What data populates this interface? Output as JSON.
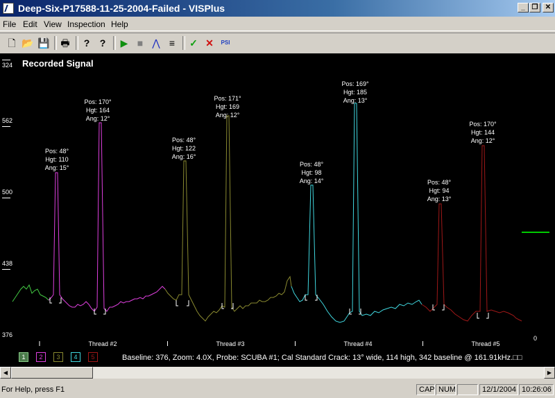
{
  "window": {
    "title": "Deep-Six-P17588-11-25-2004-Failed - VISPlus",
    "min_glyph": "_",
    "max_glyph": "❐",
    "close_glyph": "✕"
  },
  "menu": [
    "File",
    "Edit",
    "View",
    "Inspection",
    "Help"
  ],
  "toolbar": [
    {
      "name": "new",
      "icon": "new-document-icon",
      "glyph": "🗋"
    },
    {
      "name": "open",
      "icon": "open-folder-icon",
      "glyph": "📂"
    },
    {
      "name": "save",
      "icon": "save-disk-icon",
      "glyph": "💾"
    },
    {
      "name": "print",
      "icon": "printer-icon",
      "glyph": "🖶"
    },
    {
      "name": "help",
      "icon": "help-icon",
      "glyph": "?"
    },
    {
      "name": "context-help",
      "icon": "context-help-icon",
      "glyph": "?"
    },
    {
      "name": "play",
      "icon": "play-icon",
      "glyph": "▶"
    },
    {
      "name": "stop",
      "icon": "stop-icon",
      "glyph": "■"
    },
    {
      "name": "peak",
      "icon": "peak-icon",
      "glyph": "⋀"
    },
    {
      "name": "lines",
      "icon": "lines-icon",
      "glyph": "≡"
    },
    {
      "name": "accept",
      "icon": "check-icon",
      "glyph": "✓"
    },
    {
      "name": "reject",
      "icon": "cross-icon",
      "glyph": "✕"
    },
    {
      "name": "psi",
      "icon": "psi-icon",
      "glyph": "PSI"
    }
  ],
  "plot": {
    "title": "Recorded Signal",
    "y_labels": [
      "324",
      "562",
      "500",
      "438",
      "376"
    ],
    "zero_label": "0",
    "threads": [
      "Thread #2",
      "Thread #3",
      "Thread #4",
      "Thread #5"
    ],
    "annotations": [
      {
        "pos": "Pos: 48°",
        "hgt": "Hgt: 110",
        "ang": "Ang: 15°"
      },
      {
        "pos": "Pos: 170°",
        "hgt": "Hgt: 164",
        "ang": "Ang: 12°"
      },
      {
        "pos": "Pos: 48°",
        "hgt": "Hgt: 122",
        "ang": "Ang: 16°"
      },
      {
        "pos": "Pos: 171°",
        "hgt": "Hgt: 169",
        "ang": "Ang: 12°"
      },
      {
        "pos": "Pos: 48°",
        "hgt": "Hgt: 98",
        "ang": "Ang: 14°"
      },
      {
        "pos": "Pos: 169°",
        "hgt": "Hgt: 185",
        "ang": "Ang: 13°"
      },
      {
        "pos": "Pos: 48°",
        "hgt": "Hgt: 94",
        "ang": "Ang: 13°"
      },
      {
        "pos": "Pos: 170°",
        "hgt": "Hgt: 144",
        "ang": "Ang: 12°"
      }
    ],
    "channels": [
      {
        "label": "1",
        "color": "#44cc44"
      },
      {
        "label": "2",
        "color": "#e040e0"
      },
      {
        "label": "3",
        "color": "#8a8a30"
      },
      {
        "label": "4",
        "color": "#40d8e0"
      },
      {
        "label": "5",
        "color": "#a01818"
      }
    ],
    "baseline_text": "Baseline: 376, Zoom: 4.0X, Probe: SCUBA #1; Cal Standard Crack: 13° wide, 114 high, 342 baseline @ 161.91kHz.□□",
    "colors": {
      "background": "#000000",
      "marker": "#00cc00"
    }
  },
  "scrollbar": {
    "left_glyph": "◀",
    "right_glyph": "▶"
  },
  "status": {
    "help": "For Help, press F1",
    "cap": "CAP",
    "num": "NUM",
    "blank": "",
    "date": "12/1/2004",
    "time": "10:26:06"
  }
}
